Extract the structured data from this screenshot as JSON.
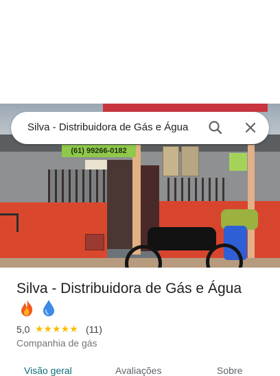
{
  "search": {
    "query": "Silva - Distribuidora de Gás e Água",
    "search_icon": "search-icon",
    "close_icon": "close-icon"
  },
  "photo": {
    "phone_sign_text": "(61) 99266-0182",
    "description_icon": "storefront-photo"
  },
  "place": {
    "title": "Silva - Distribuidora de Gás e Água",
    "emojis": [
      "fire-emoji",
      "droplet-emoji"
    ],
    "rating": "5,0",
    "stars": "★★★★★",
    "reviews": "(11)",
    "category": "Companhia de gás"
  },
  "tabs": [
    {
      "label": "Visão geral",
      "active": true
    },
    {
      "label": "Avaliações",
      "active": false
    },
    {
      "label": "Sobre",
      "active": false
    }
  ],
  "colors": {
    "accent": "#0b6e79",
    "star": "#fbbc04",
    "text": "#202124",
    "secondary_text": "#70757a"
  }
}
